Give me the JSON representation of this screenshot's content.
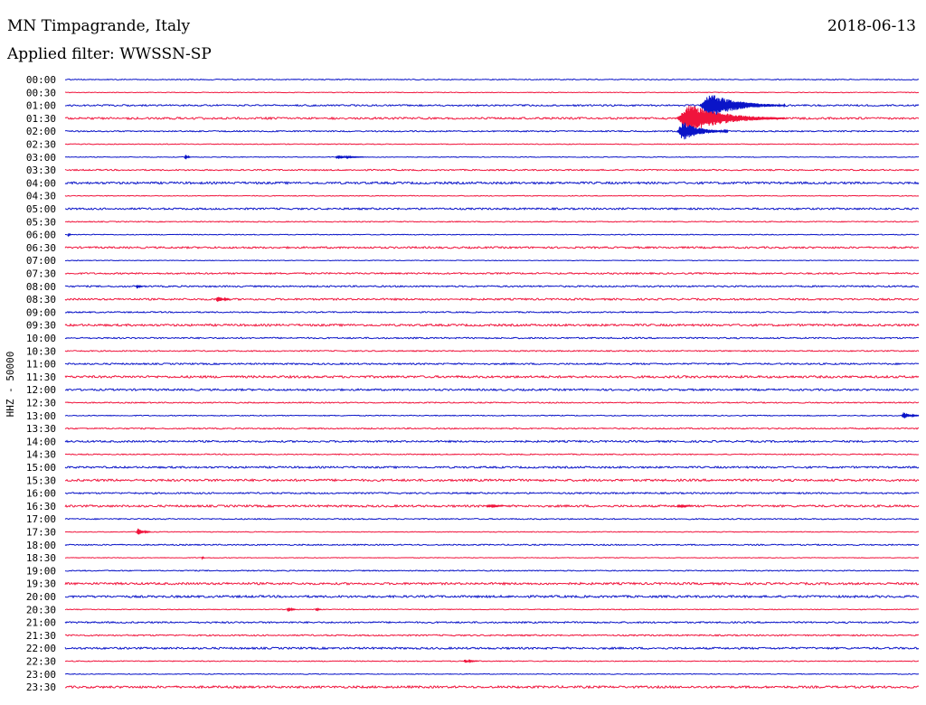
{
  "header": {
    "station": "MN Timpagrande, Italy",
    "filter": "Applied filter: WWSSN-SP",
    "date": "2018-06-13"
  },
  "axis": {
    "y_label": "HHZ - 50000"
  },
  "colors": {
    "trace_a": "#0a14c8",
    "trace_b": "#f0143c",
    "text": "#000000",
    "background": "#ffffff"
  },
  "chart_data": {
    "type": "line",
    "title": "",
    "xlabel": "",
    "ylabel": "HHZ - 50000",
    "rows": [
      "00:00",
      "00:30",
      "01:00",
      "01:30",
      "02:00",
      "02:30",
      "03:00",
      "03:30",
      "04:00",
      "04:30",
      "05:00",
      "05:30",
      "06:00",
      "06:30",
      "07:00",
      "07:30",
      "08:00",
      "08:30",
      "09:00",
      "09:30",
      "10:00",
      "10:30",
      "11:00",
      "11:30",
      "12:00",
      "12:30",
      "13:00",
      "13:30",
      "14:00",
      "14:30",
      "15:00",
      "15:30",
      "16:00",
      "16:30",
      "17:00",
      "17:30",
      "18:00",
      "18:30",
      "19:00",
      "19:30",
      "20:00",
      "20:30",
      "21:00",
      "21:30",
      "22:00",
      "22:30",
      "23:00",
      "23:30"
    ],
    "row_colors": [
      "#0a14c8",
      "#f0143c"
    ],
    "minutes_per_row": 30,
    "events": [
      {
        "row": "01:00",
        "minute": 22.3,
        "amplitude": 14,
        "duration_min": 3.0
      },
      {
        "row": "01:30",
        "minute": 21.5,
        "amplitude": 16,
        "duration_min": 3.8
      },
      {
        "row": "02:00",
        "minute": 21.5,
        "amplitude": 11,
        "duration_min": 1.8
      },
      {
        "row": "03:00",
        "minute": 4.2,
        "amplitude": 4,
        "duration_min": 0.2
      },
      {
        "row": "03:00",
        "minute": 9.5,
        "amplitude": 2,
        "duration_min": 1.0
      },
      {
        "row": "06:00",
        "minute": 0.1,
        "amplitude": 3,
        "duration_min": 0.1
      },
      {
        "row": "08:00",
        "minute": 2.5,
        "amplitude": 3,
        "duration_min": 0.2
      },
      {
        "row": "08:30",
        "minute": 5.3,
        "amplitude": 4,
        "duration_min": 0.5
      },
      {
        "row": "13:00",
        "minute": 29.4,
        "amplitude": 4,
        "duration_min": 0.6
      },
      {
        "row": "16:30",
        "minute": 14.8,
        "amplitude": 2,
        "duration_min": 0.6
      },
      {
        "row": "16:30",
        "minute": 21.5,
        "amplitude": 2,
        "duration_min": 0.5
      },
      {
        "row": "17:30",
        "minute": 2.5,
        "amplitude": 4,
        "duration_min": 0.5
      },
      {
        "row": "18:30",
        "minute": 4.8,
        "amplitude": 2,
        "duration_min": 0.1
      },
      {
        "row": "20:30",
        "minute": 7.8,
        "amplitude": 3,
        "duration_min": 0.3
      },
      {
        "row": "20:30",
        "minute": 8.8,
        "amplitude": 2,
        "duration_min": 0.2
      },
      {
        "row": "22:30",
        "minute": 14.0,
        "amplitude": 2,
        "duration_min": 0.5
      }
    ]
  }
}
